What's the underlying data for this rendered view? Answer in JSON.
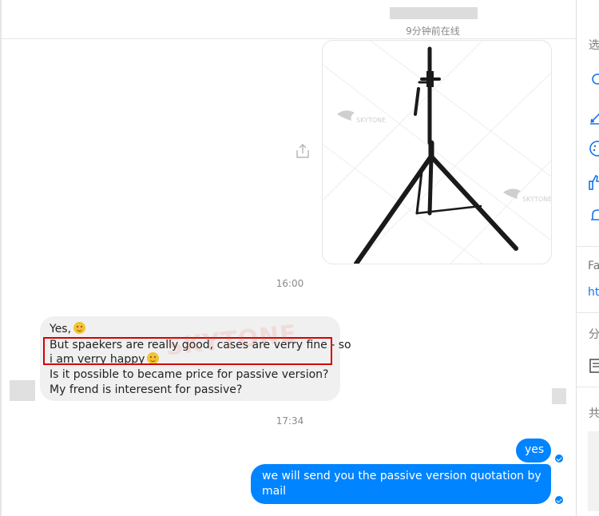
{
  "header": {
    "status": "9分钟前在线"
  },
  "messages": {
    "time1": "16:00",
    "time2": "17:34",
    "incoming": {
      "line1": "Yes,",
      "line2": "But spaekers are really good, cases are verry fine - so",
      "line3": "i am verry happy",
      "line4": "Is it possible to became price for passive version?",
      "line5": "My frend is interesent for passive?"
    },
    "out1": "yes",
    "out2_line1": "we will send you the passive version quotation by",
    "out2_line2": "mail"
  },
  "watermark": {
    "text": "SKYTONE"
  },
  "side_panel": {
    "t1": "选",
    "t2": "Fa",
    "t3": "ht",
    "t4": "分",
    "t5": "共"
  },
  "colors": {
    "accent": "#0084ff",
    "incoming_bubble": "#f1f0f0",
    "highlight_box": "#d80000"
  }
}
